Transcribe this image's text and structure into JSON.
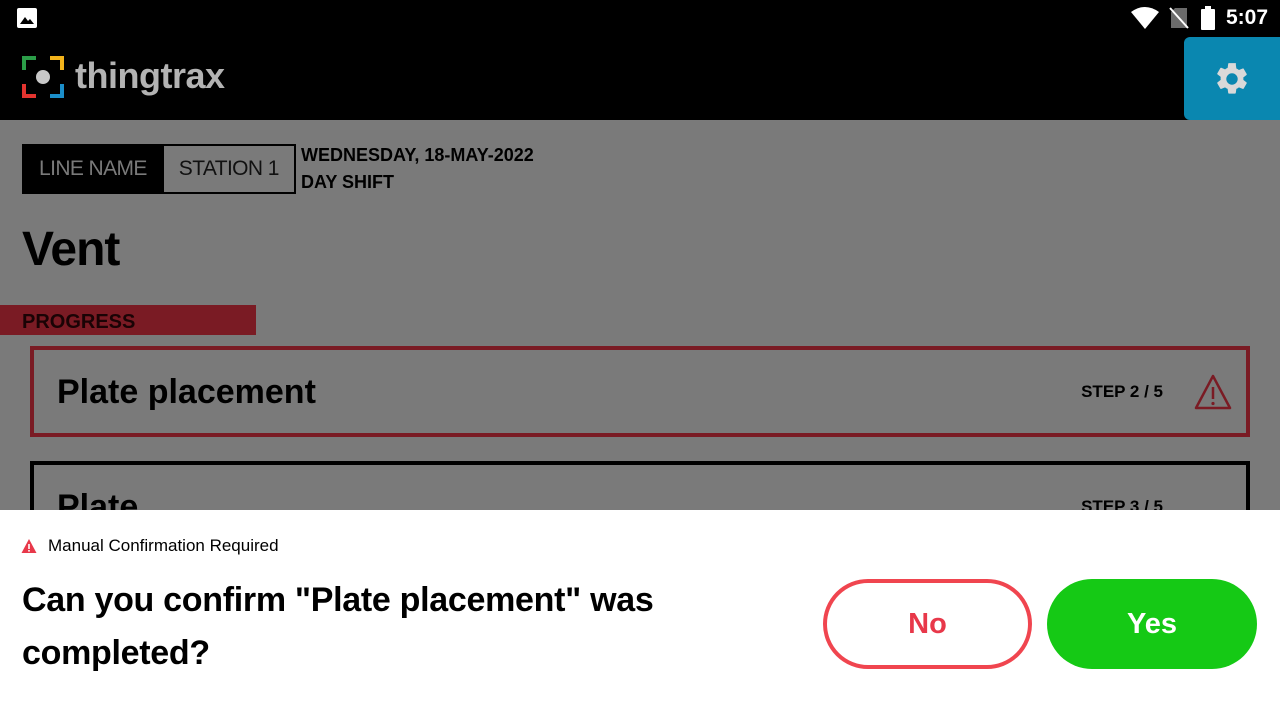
{
  "status_bar": {
    "time": "5:07",
    "icons": [
      "gallery-icon",
      "wifi-icon",
      "no-sim-icon",
      "battery-icon"
    ]
  },
  "app_bar": {
    "logo_text": "thingtrax",
    "settings_icon": "gear-icon",
    "accent_color": "#0a87b0"
  },
  "main": {
    "line_name": "LINE NAME",
    "station": "STATION 1",
    "date": "WEDNESDAY, 18-MAY-2022",
    "shift": "DAY SHIFT",
    "title": "Vent",
    "progress_label": "PROGRESS",
    "steps": [
      {
        "name": "Plate placement",
        "step": "STEP 2 / 5",
        "status": "warning"
      },
      {
        "name": "Plate",
        "step": "STEP 3 / 5",
        "status": "pending"
      }
    ]
  },
  "dialog": {
    "caption": "Manual Confirmation Required",
    "question": "Can you confirm \"Plate placement\" was completed?",
    "no_label": "No",
    "yes_label": "Yes",
    "colors": {
      "no": "#f0454f",
      "yes": "#15c915",
      "warning": "#e8384a"
    }
  }
}
